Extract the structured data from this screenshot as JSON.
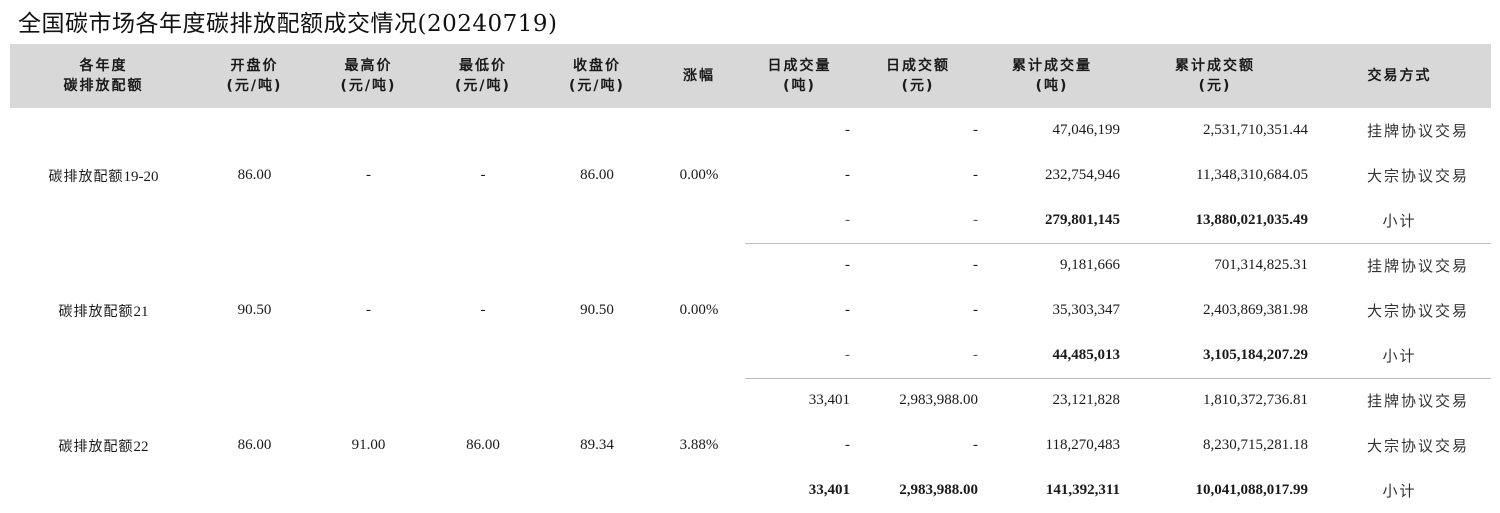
{
  "title": "全国碳市场各年度碳排放配额成交情况(20240719)",
  "headers": [
    {
      "l1": "各年度",
      "l2": "碳排放配额"
    },
    {
      "l1": "开盘价",
      "l2": "(元/吨)"
    },
    {
      "l1": "最高价",
      "l2": "(元/吨)"
    },
    {
      "l1": "最低价",
      "l2": "(元/吨)"
    },
    {
      "l1": "收盘价",
      "l2": "(元/吨)"
    },
    {
      "l1": "涨幅",
      "l2": ""
    },
    {
      "l1": "日成交量",
      "l2": "(吨)"
    },
    {
      "l1": "日成交额",
      "l2": "(元)"
    },
    {
      "l1": "累计成交量",
      "l2": "(吨)"
    },
    {
      "l1": "累计成交额",
      "l2": "(元)"
    },
    {
      "l1": "交易方式",
      "l2": ""
    }
  ],
  "groups": [
    {
      "name_prefix": "碳排放配额",
      "name_suffix": "19-20",
      "open": "86.00",
      "high": "-",
      "low": "-",
      "close": "86.00",
      "change": "0.00%",
      "rows": [
        {
          "daily_vol": "-",
          "daily_amt": "-",
          "cum_vol": "47,046,199",
          "cum_amt": "2,531,710,351.44",
          "mode": "挂牌协议交易"
        },
        {
          "daily_vol": "-",
          "daily_amt": "-",
          "cum_vol": "232,754,946",
          "cum_amt": "11,348,310,684.05",
          "mode": "大宗协议交易"
        },
        {
          "daily_vol": "-",
          "daily_amt": "-",
          "cum_vol": "279,801,145",
          "cum_amt": "13,880,021,035.49",
          "mode": "小计"
        }
      ]
    },
    {
      "name_prefix": "碳排放配额",
      "name_suffix": "21",
      "open": "90.50",
      "high": "-",
      "low": "-",
      "close": "90.50",
      "change": "0.00%",
      "rows": [
        {
          "daily_vol": "-",
          "daily_amt": "-",
          "cum_vol": "9,181,666",
          "cum_amt": "701,314,825.31",
          "mode": "挂牌协议交易"
        },
        {
          "daily_vol": "-",
          "daily_amt": "-",
          "cum_vol": "35,303,347",
          "cum_amt": "2,403,869,381.98",
          "mode": "大宗协议交易"
        },
        {
          "daily_vol": "-",
          "daily_amt": "-",
          "cum_vol": "44,485,013",
          "cum_amt": "3,105,184,207.29",
          "mode": "小计"
        }
      ]
    },
    {
      "name_prefix": "碳排放配额",
      "name_suffix": "22",
      "open": "86.00",
      "high": "91.00",
      "low": "86.00",
      "close": "89.34",
      "change": "3.88%",
      "rows": [
        {
          "daily_vol": "33,401",
          "daily_amt": "2,983,988.00",
          "cum_vol": "23,121,828",
          "cum_amt": "1,810,372,736.81",
          "mode": "挂牌协议交易"
        },
        {
          "daily_vol": "-",
          "daily_amt": "-",
          "cum_vol": "118,270,483",
          "cum_amt": "8,230,715,281.18",
          "mode": "大宗协议交易"
        },
        {
          "daily_vol": "33,401",
          "daily_amt": "2,983,988.00",
          "cum_vol": "141,392,311",
          "cum_amt": "10,041,088,017.99",
          "mode": "小计"
        }
      ]
    }
  ]
}
